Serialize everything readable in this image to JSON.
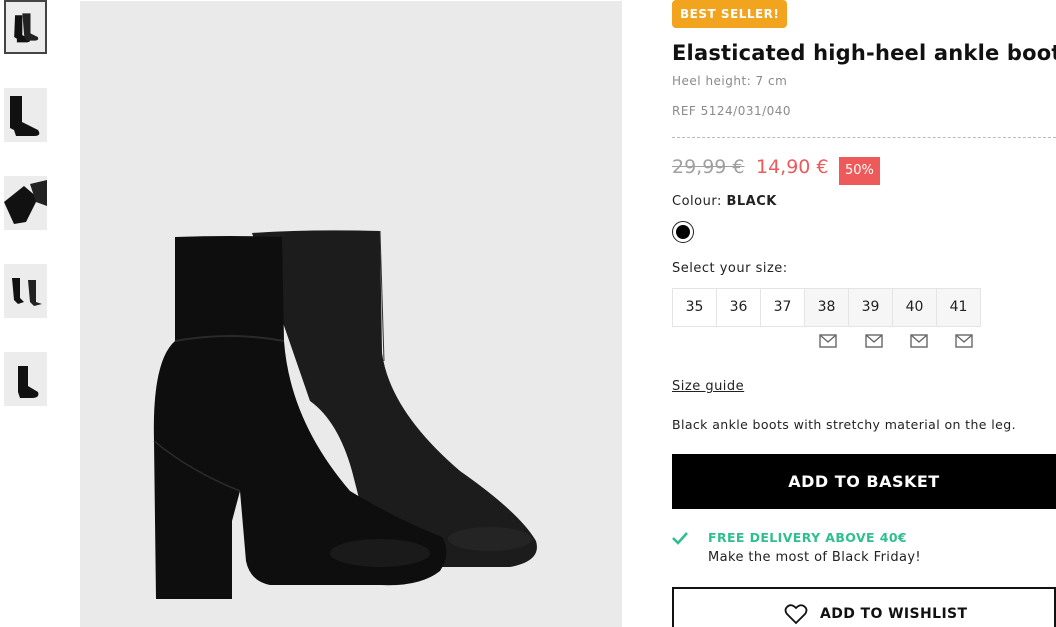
{
  "thumbnails": [
    {
      "name": "thumb-1",
      "view": "pair-front"
    },
    {
      "name": "thumb-2",
      "view": "side"
    },
    {
      "name": "thumb-3",
      "view": "detail"
    },
    {
      "name": "thumb-4",
      "view": "worn-pair"
    },
    {
      "name": "thumb-5",
      "view": "worn-single"
    }
  ],
  "product": {
    "badge": "BEST SELLER!",
    "title": "Elasticated high-heel ankle boots",
    "heel_height": "Heel height: 7 cm",
    "ref": "REF 5124/031/040",
    "old_price": "29,99 €",
    "new_price": "14,90 €",
    "discount": "50%",
    "colour_label": "Colour:",
    "colour_value": "BLACK",
    "size_label": "Select your size:",
    "sizes": [
      "35",
      "36",
      "37",
      "38",
      "39",
      "40",
      "41"
    ],
    "size_guide": "Size guide",
    "description": "Black ankle boots with stretchy material on the leg.",
    "add_to_basket": "ADD TO BASKET",
    "delivery_title": "FREE DELIVERY ABOVE 40€",
    "delivery_sub": "Make the most of Black Friday!",
    "add_to_wishlist": "ADD TO WISHLIST"
  },
  "colors": {
    "badge": "#f3a41f",
    "sale": "#ee5a5a",
    "delivery": "#2fbf8f",
    "button": "#000000"
  },
  "icons": {
    "notify": "mail-icon",
    "delivery": "checkmark-icon",
    "wishlist": "heart-icon"
  }
}
